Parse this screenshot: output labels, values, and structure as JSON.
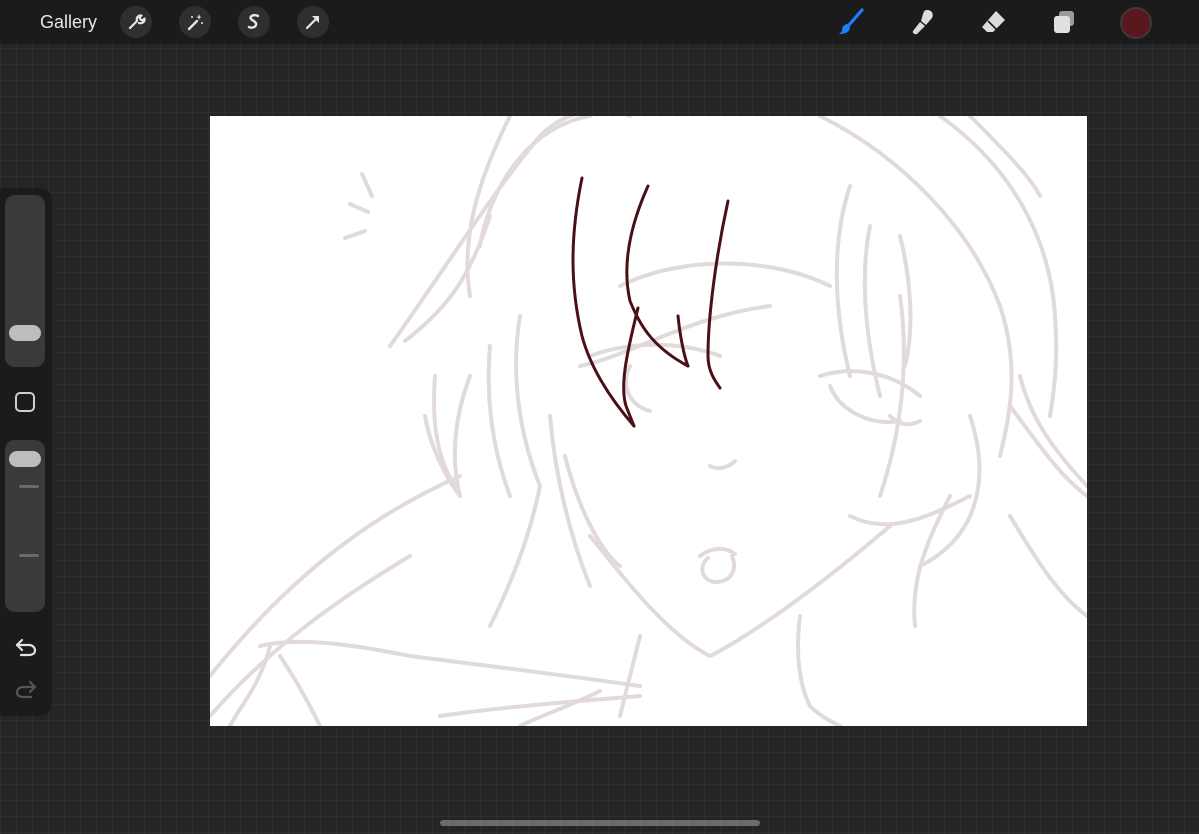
{
  "topbar": {
    "gallery_label": "Gallery",
    "left_tools": [
      {
        "icon": "wrench-icon",
        "name": "actions"
      },
      {
        "icon": "magic-wand-icon",
        "name": "adjustments"
      },
      {
        "icon": "selection-icon",
        "name": "selection"
      },
      {
        "icon": "transform-arrow-icon",
        "name": "transform"
      }
    ],
    "right_tools": [
      {
        "icon": "brush-icon",
        "name": "brush",
        "active": true
      },
      {
        "icon": "smudge-icon",
        "name": "smudge"
      },
      {
        "icon": "eraser-icon",
        "name": "eraser"
      },
      {
        "icon": "layers-icon",
        "name": "layers"
      }
    ],
    "current_color": "#5b1620"
  },
  "sidebar": {
    "brush_size_level": 0.85,
    "opacity_level": 0.05,
    "icons": [
      "modify-square-icon",
      "undo-icon",
      "redo-icon"
    ]
  },
  "canvas": {
    "background": "#ffffff",
    "sketch_color": "#e2dada",
    "ink_color": "#4a0f17"
  },
  "colors": {
    "accent": "#1e7cff",
    "bar": "#1b1b1b",
    "workspace": "#252525"
  }
}
